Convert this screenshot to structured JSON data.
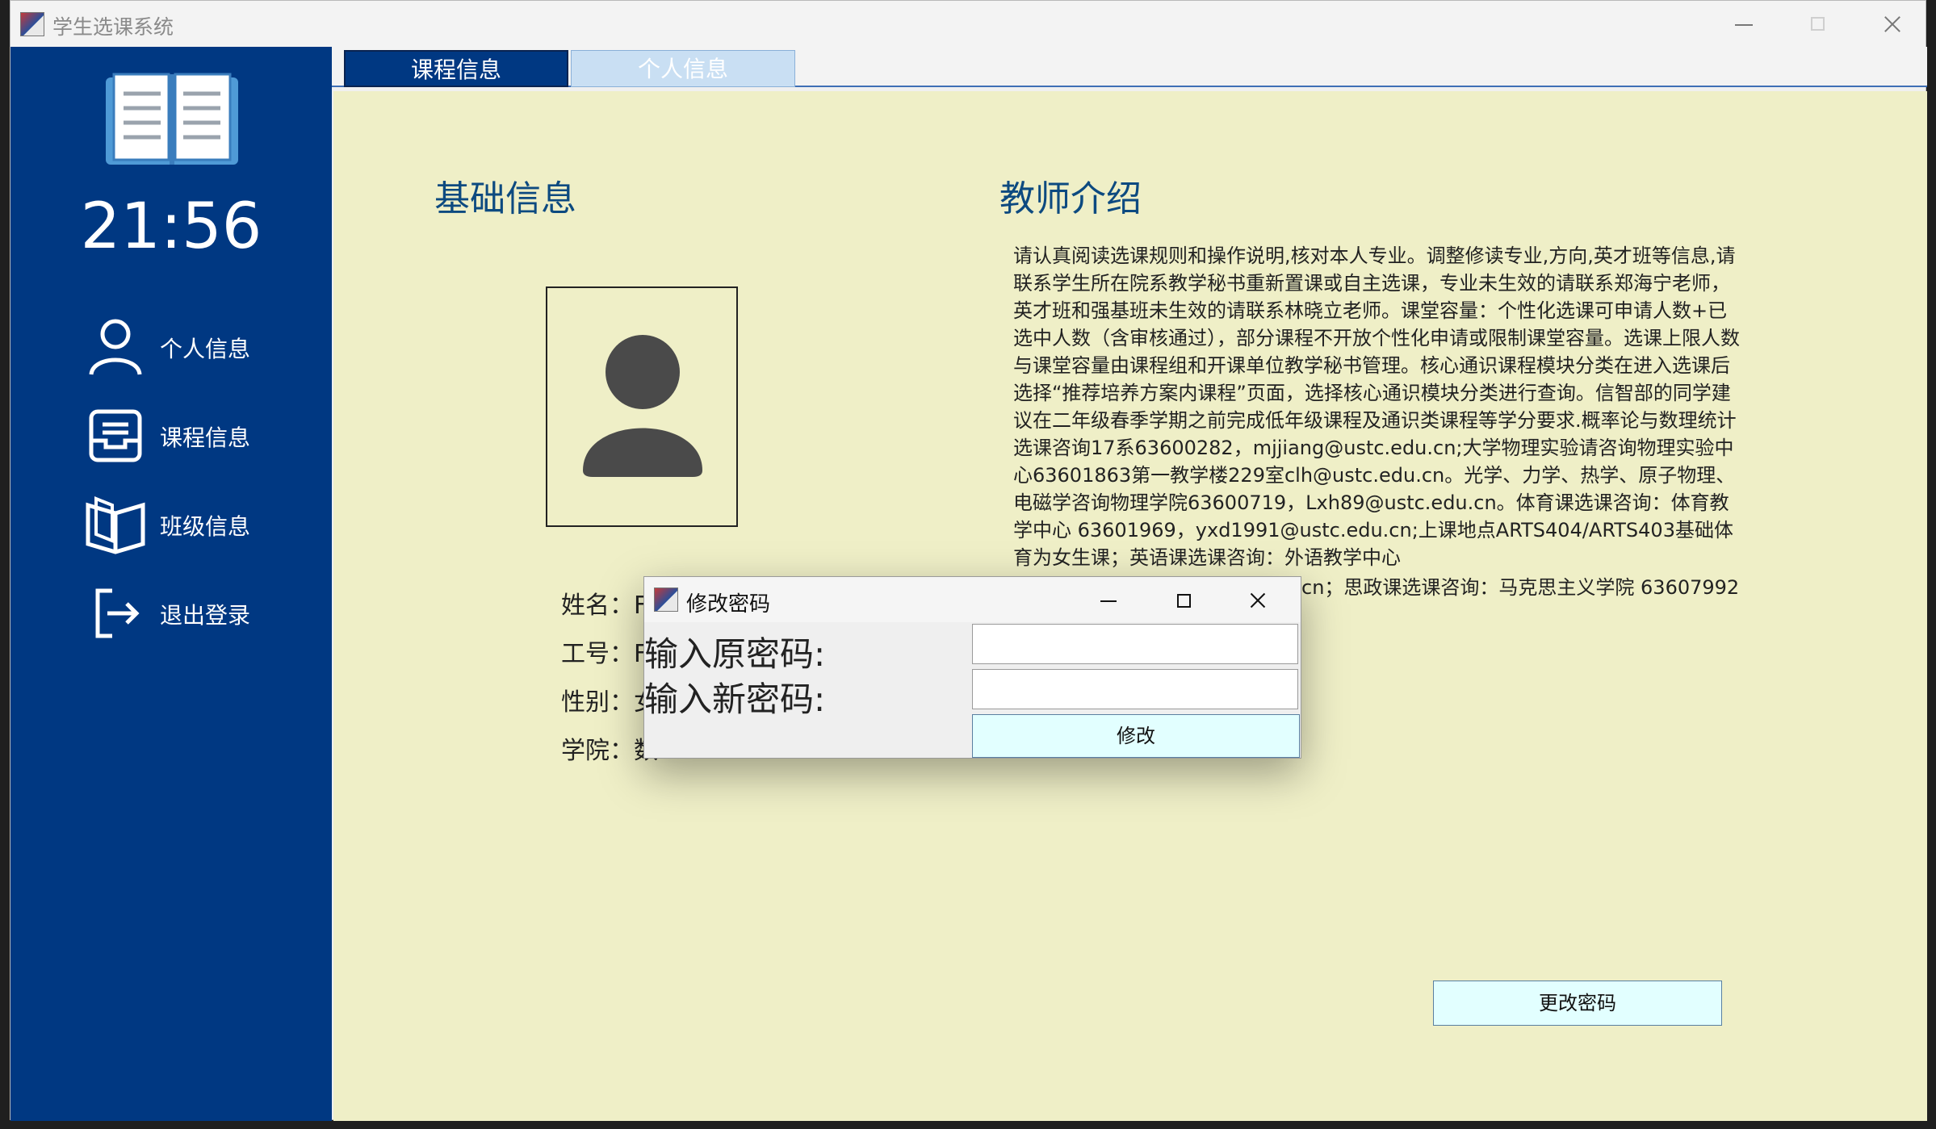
{
  "window": {
    "title": "学生选课系统"
  },
  "sidebar": {
    "clock": "21:56",
    "items": [
      {
        "label": "个人信息",
        "icon": "user-icon"
      },
      {
        "label": "课程信息",
        "icon": "inbox-tray-icon"
      },
      {
        "label": "班级信息",
        "icon": "open-book-icon"
      },
      {
        "label": "退出登录",
        "icon": "logout-icon"
      }
    ]
  },
  "tabs": [
    {
      "label": "课程信息",
      "active": true
    },
    {
      "label": "个人信息",
      "active": false
    }
  ],
  "main": {
    "basic_heading": "基础信息",
    "teacher_heading": "教师介绍",
    "info_rows": [
      {
        "label": "姓名：",
        "value": "F"
      },
      {
        "label": "工号：",
        "value": "F"
      },
      {
        "label": "性别：",
        "value": "女"
      },
      {
        "label": "学院：",
        "value": "数"
      }
    ],
    "intro_text": "请认真阅读选课规则和操作说明,核对本人专业。调整修读专业,方向,英才班等信息,请联系学生所在院系教学秘书重新置课或自主选课，专业未生效的请联系郑海宁老师，英才班和强基班未生效的请联系林晓立老师。课堂容量：个性化选课可申请人数+已选中人数（含审核通过），部分课程不开放个性化申请或限制课堂容量。选课上限人数与课堂容量由课程组和开课单位教学秘书管理。核心通识课程模块分类在进入选课后选择“推荐培养方案内课程”页面，选择核心通识模块分类进行查询。信智部的同学建议在二年级春季学期之前完成低年级课程及通识类课程等学分要求.概率论与数理统计选课咨询17系63600282，mjjiang@ustc.edu.cn;大学物理实验请咨询物理实验中心63601863第一教学楼229室clh@ustc.edu.cn。光学、力学、热学、原子物理、电磁学咨询物理学院63600719，Lxh89@ustc.edu.cn。体育课选课咨询：体育教学中心 63601969，yxd1991@ustc.edu.cn;上课地点ARTS404/ARTS403基础体育为女生课；英语课选课咨询：外语教学中心",
    "intro_tail": "cn；思政课选课咨询：马克思主义学院 63607992",
    "change_password_button": "更改密码"
  },
  "dialog": {
    "title": "修改密码",
    "old_password_label": "输入原密码:",
    "new_password_label": "输入新密码:",
    "old_password_value": "",
    "new_password_value": "",
    "submit_label": "修改"
  },
  "colors": {
    "sidebar_bg": "#003882",
    "content_bg": "#efefc7",
    "heading": "#0d4a80",
    "button_bg": "#e2ffff"
  }
}
